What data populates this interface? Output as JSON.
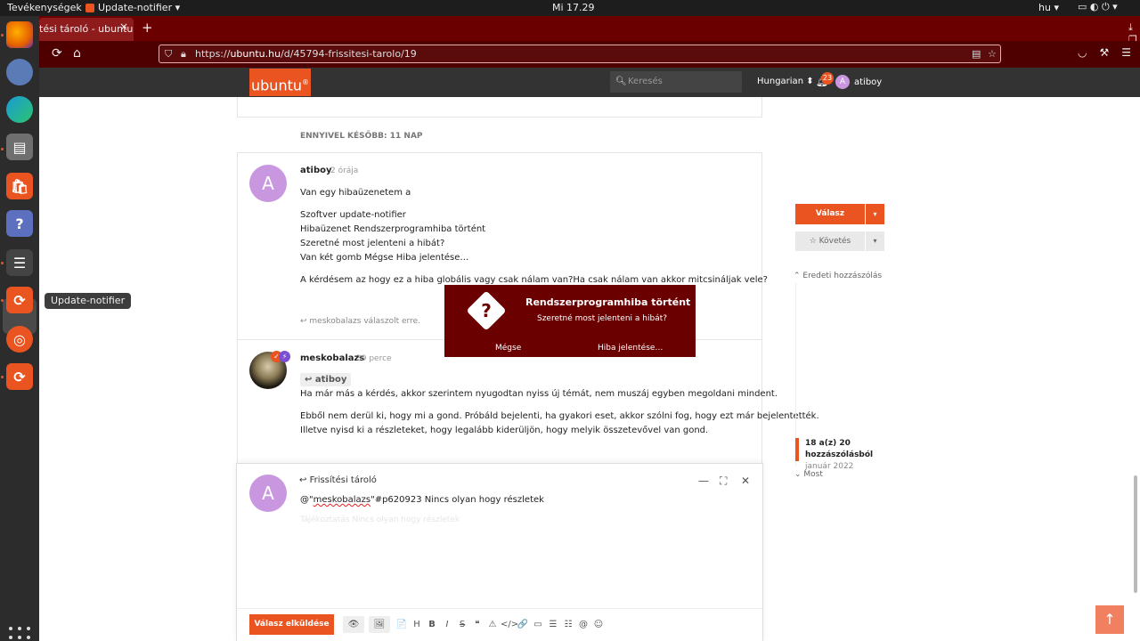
{
  "topbar": {
    "activities": "Tevékenységek",
    "app_menu": "Update-notifier ▾",
    "clock": "Mi 17.29",
    "lang": "hu ▾",
    "tray": "▭  ◐  ⏻ ▾"
  },
  "dock": {
    "tooltip": "Update-notifier",
    "accent": "#e95420"
  },
  "browser": {
    "tab_title": "tési tároló - ubuntu",
    "tab_close": "×",
    "new_tab": "+",
    "url_prefix": "https://",
    "url_domain": "ubuntu.hu",
    "url_path": "/d/45794-frissitesi-tarolo/19",
    "win_controls": "⤓ ❐ ✕"
  },
  "site": {
    "logo": "ubuntu",
    "search_placeholder": "Keresés",
    "language": "Hungarian ⬍",
    "notif_count": "23",
    "user_initial": "A",
    "user_name": "atiboy",
    "time_gap": "ENNYIVEL KÉSŐBB: 11 NAP"
  },
  "posts": [
    {
      "avatar": "A",
      "user": "atiboy",
      "time": "2 órája",
      "lines": [
        "Van egy hibaüzenetem a",
        "Szoftver update-notifier",
        "Hibaüzenet Rendszerprogramhiba történt",
        "Szeretné most jelenteni a hibát?",
        "Van két gomb Mégse Hiba jelentése…",
        "A kérdésem az hogy ez a hiba globális vagy csak nálam van?Ha csak nálam van akkor mitcsináljak vele?"
      ],
      "replied": "meskobalazs válaszolt erre."
    },
    {
      "user": "meskobalazs",
      "time": "39 perce",
      "reply_to": "atiboy",
      "lines": [
        "Ha már más a kérdés, akkor szerintem nyugodtan nyiss új témát, nem muszáj egyben megoldani mindent.",
        "Ebből nem derül ki, hogy mi a gond. Próbáld bejelenti, ha gyakori eset, akkor szólni fog, hogy ezt már bejelentették.",
        "Illetve nyisd ki a részleteket, hogy legalább kiderüljön, hogy melyik összetevővel van gond."
      ]
    }
  ],
  "sidebar": {
    "reply": "Válasz",
    "follow": "Követés",
    "original_post": "Eredeti hozzászólás",
    "timeline_count_1": "18 a(z) 20",
    "timeline_count_2": "hozzászólásból",
    "timeline_date": "január 2022",
    "timeline_now": "Most"
  },
  "composer": {
    "title": "Frissítési tároló",
    "avatar": "A",
    "text_pre": "@\"",
    "text_mention": "meskobalazs",
    "text_post": "\"#p620923 Nincs olyan hogy részletek",
    "ghost": "Tájékoztatás        Nincs olyan hogy részletek",
    "send": "Válasz elküldése",
    "tools": [
      "👁",
      "🖼",
      "📄",
      "H",
      "B",
      "I",
      "S",
      "❝",
      "⚠",
      "</>",
      "🔗",
      "▭",
      "☰",
      "☷",
      "@",
      "☺"
    ]
  },
  "dialog": {
    "title": "Rendszerprogramhiba történt",
    "message": "Szeretné most jelenteni a hibát?",
    "cancel": "Mégse",
    "report": "Hiba jelentése…"
  }
}
